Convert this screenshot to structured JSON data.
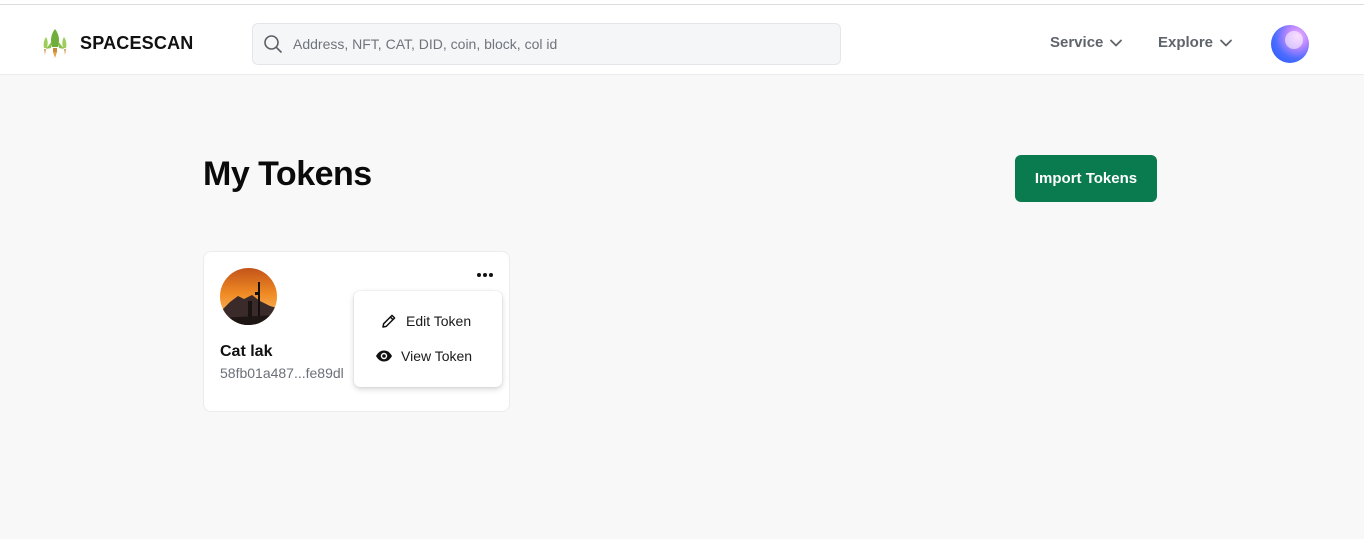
{
  "brand": {
    "name": "SPACESCAN",
    "logo_icon": "rocket-logo-icon"
  },
  "search": {
    "placeholder": "Address, NFT, CAT, DID, coin, block, col id",
    "icon": "search-icon"
  },
  "nav": {
    "service_label": "Service",
    "explore_label": "Explore"
  },
  "page": {
    "title": "My Tokens",
    "import_label": "Import Tokens"
  },
  "token": {
    "name": "Cat lak",
    "id_short": "58fb01a487...fe89dl"
  },
  "menu": {
    "edit_label": "Edit Token",
    "view_label": "View Token"
  },
  "colors": {
    "accent": "#0a7a4f",
    "background": "#f8f8f8",
    "nav_text": "#5f646b"
  }
}
